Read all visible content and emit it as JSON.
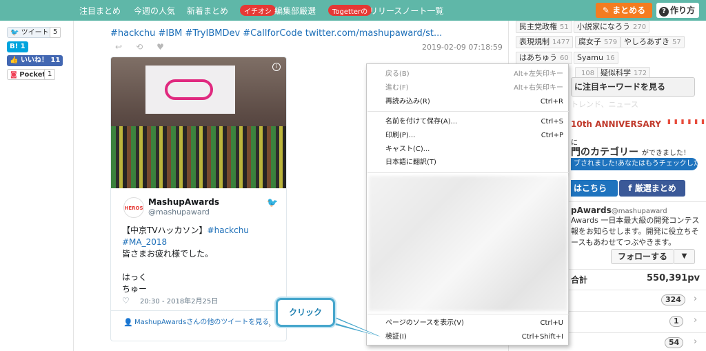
{
  "nav": {
    "items": [
      "注目まとめ",
      "今週の人気",
      "新着まとめ"
    ],
    "badge1": "イチオシ",
    "item4": "編集部厳選",
    "badge2": "Togetterの",
    "item5": "リリースノート一覧",
    "matome_button": "まとめる",
    "howto_button": "作り方"
  },
  "share": {
    "tweet_label": "ツイート",
    "tweet_count": "5",
    "hatena_label": "B! 1",
    "like_label": "いいね！ 11",
    "pocket_label": "Pocket",
    "pocket_count": "1"
  },
  "post": {
    "hashtags": "#hackchu #IBM #TryIBMDev #CallforCode twitter.com/mashupaward/st...",
    "date": "2019-02-09 07:18:59"
  },
  "tweet": {
    "avatar_text": "HEROS",
    "author_name": "MashupAwards",
    "author_handle": "@mashupaward",
    "line1_text": "【中京TVハッカソン】",
    "line1_tag": "#hackchu",
    "line2_tag": "#MA_2018",
    "line3": "皆さまお疲れ様でした。",
    "line4": "",
    "line5": "はっく",
    "line6": "ちゅー",
    "time": "20:30 - 2018年2月25日",
    "more_link": "MashupAwardsさんの他のツイートを見る"
  },
  "context_menu": {
    "back": {
      "label": "戻る(B)",
      "shortcut": "Alt+左矢印キー"
    },
    "forward": {
      "label": "進む(F)",
      "shortcut": "Alt+右矢印キー"
    },
    "reload": {
      "label": "再読み込み(R)",
      "shortcut": "Ctrl+R"
    },
    "save_as": {
      "label": "名前を付けて保存(A)...",
      "shortcut": "Ctrl+S"
    },
    "print": {
      "label": "印刷(P)...",
      "shortcut": "Ctrl+P"
    },
    "cast": {
      "label": "キャスト(C)..."
    },
    "translate": {
      "label": "日本語に翻訳(T)"
    },
    "view_source": {
      "label": "ページのソースを表示(V)",
      "shortcut": "Ctrl+U"
    },
    "inspect": {
      "label": "検証(I)",
      "shortcut": "Ctrl+Shift+I"
    }
  },
  "callout": {
    "text": "クリック",
    "color": "#46a6cc"
  },
  "sidebar": {
    "keywords": [
      {
        "label": "民主党政権",
        "count": "51"
      },
      {
        "label": "小説家になろう",
        "count": "270"
      },
      {
        "label": "表現規制",
        "count": "1477"
      },
      {
        "label": "腐女子",
        "count": "579"
      },
      {
        "label": "やしろあずき",
        "count": "57"
      },
      {
        "label": "はあちゅう",
        "count": "60"
      },
      {
        "label": "Syamu",
        "count": "16"
      },
      {
        "label": "",
        "count": "108"
      },
      {
        "label": "疑似科学",
        "count": "172"
      }
    ],
    "keywords_more": "に注目キーワードを見る",
    "faded_text": "トレンド、ニュース",
    "anniversary": "10th ANNIVERSARY",
    "promo_line1": "に",
    "promo_line2": "門のカテゴリー",
    "promo_line2_small": "ができました！",
    "promo_banner": "ブされました!あなたはもうチェックした?",
    "btn_here": "はこちら",
    "btn_fb": "厳選まとめ",
    "profile_name": "pAwards",
    "profile_handle": "@mashupaward",
    "profile_bio": [
      "Awards 一日本最大級の開発コンテス",
      "報をお知らせします。開発に役立ちそ",
      "ースもあわせてつぶやきます。"
    ],
    "follow_button": "フォローする",
    "total_label": "合計",
    "total_value": "550,391pv",
    "counts": [
      "324",
      "1",
      "54"
    ]
  },
  "colors": {
    "nav_bg": "#5fb7a8",
    "matome_orange": "#f47c20",
    "link_blue": "#1d6fb8",
    "twitter_blue": "#1da1f2",
    "facebook_blue": "#3b5998"
  }
}
